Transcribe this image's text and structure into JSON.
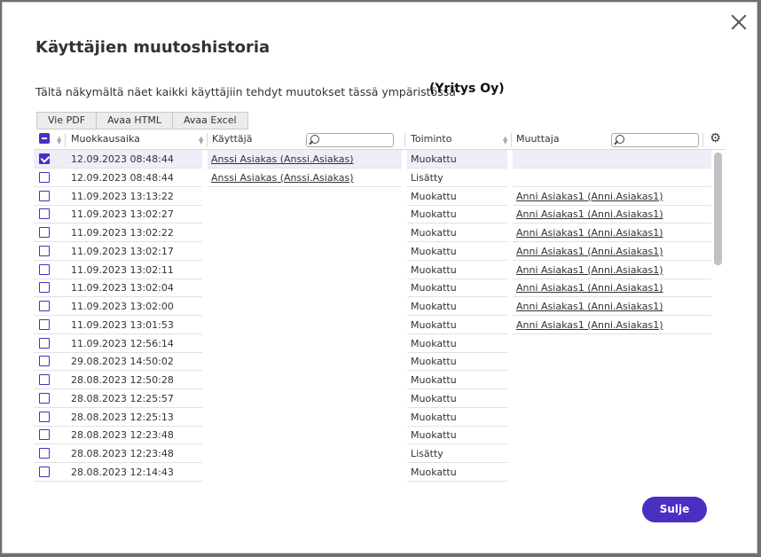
{
  "dialog": {
    "title": "Käyttäjien muutoshistoria",
    "description": "Tältä näkymältä näet kaikki käyttäjiin tehdyt muutokset tässä ympäristössä",
    "company": "(Yritys Oy)",
    "close_label": "Sulje"
  },
  "toolbar": {
    "pdf": "Vie PDF",
    "html": "Avaa HTML",
    "excel": "Avaa Excel"
  },
  "columns": {
    "modified": "Muokkausaika",
    "user": "Käyttäjä",
    "action": "Toiminto",
    "changer": "Muuttaja"
  },
  "rows": [
    {
      "time": "12.09.2023 08:48:44",
      "user": "Anssi Asiakas (Anssi.Asiakas)",
      "action": "Muokattu",
      "changer": "",
      "checked": true
    },
    {
      "time": "12.09.2023 08:48:44",
      "user": "Anssi Asiakas (Anssi.Asiakas)",
      "action": "Lisätty",
      "changer": "",
      "checked": false
    },
    {
      "time": "11.09.2023 13:13:22",
      "user": "",
      "action": "Muokattu",
      "changer": "Anni Asiakas1 (Anni.Asiakas1)",
      "checked": false
    },
    {
      "time": "11.09.2023 13:02:27",
      "user": "",
      "action": "Muokattu",
      "changer": "Anni Asiakas1 (Anni.Asiakas1)",
      "checked": false
    },
    {
      "time": "11.09.2023 13:02:22",
      "user": "",
      "action": "Muokattu",
      "changer": "Anni Asiakas1 (Anni.Asiakas1)",
      "checked": false
    },
    {
      "time": "11.09.2023 13:02:17",
      "user": "",
      "action": "Muokattu",
      "changer": "Anni Asiakas1 (Anni.Asiakas1)",
      "checked": false
    },
    {
      "time": "11.09.2023 13:02:11",
      "user": "",
      "action": "Muokattu",
      "changer": "Anni Asiakas1 (Anni.Asiakas1)",
      "checked": false
    },
    {
      "time": "11.09.2023 13:02:04",
      "user": "",
      "action": "Muokattu",
      "changer": "Anni Asiakas1 (Anni.Asiakas1)",
      "checked": false
    },
    {
      "time": "11.09.2023 13:02:00",
      "user": "",
      "action": "Muokattu",
      "changer": "Anni Asiakas1 (Anni.Asiakas1)",
      "checked": false
    },
    {
      "time": "11.09.2023 13:01:53",
      "user": "",
      "action": "Muokattu",
      "changer": "Anni Asiakas1 (Anni.Asiakas1)",
      "checked": false
    },
    {
      "time": "11.09.2023 12:56:14",
      "user": "",
      "action": "Muokattu",
      "changer": "",
      "checked": false
    },
    {
      "time": "29.08.2023 14:50:02",
      "user": "",
      "action": "Muokattu",
      "changer": "",
      "checked": false
    },
    {
      "time": "28.08.2023 12:50:28",
      "user": "",
      "action": "Muokattu",
      "changer": "",
      "checked": false
    },
    {
      "time": "28.08.2023 12:25:57",
      "user": "",
      "action": "Muokattu",
      "changer": "",
      "checked": false
    },
    {
      "time": "28.08.2023 12:25:13",
      "user": "",
      "action": "Muokattu",
      "changer": "",
      "checked": false
    },
    {
      "time": "28.08.2023 12:23:48",
      "user": "",
      "action": "Muokattu",
      "changer": "",
      "checked": false
    },
    {
      "time": "28.08.2023 12:23:48",
      "user": "",
      "action": "Lisätty",
      "changer": "",
      "checked": false
    },
    {
      "time": "28.08.2023 12:14:43",
      "user": "",
      "action": "Muokattu",
      "changer": "",
      "checked": false
    }
  ],
  "colors": {
    "accent": "#4a2fc2",
    "selected_row": "#efedf8"
  }
}
